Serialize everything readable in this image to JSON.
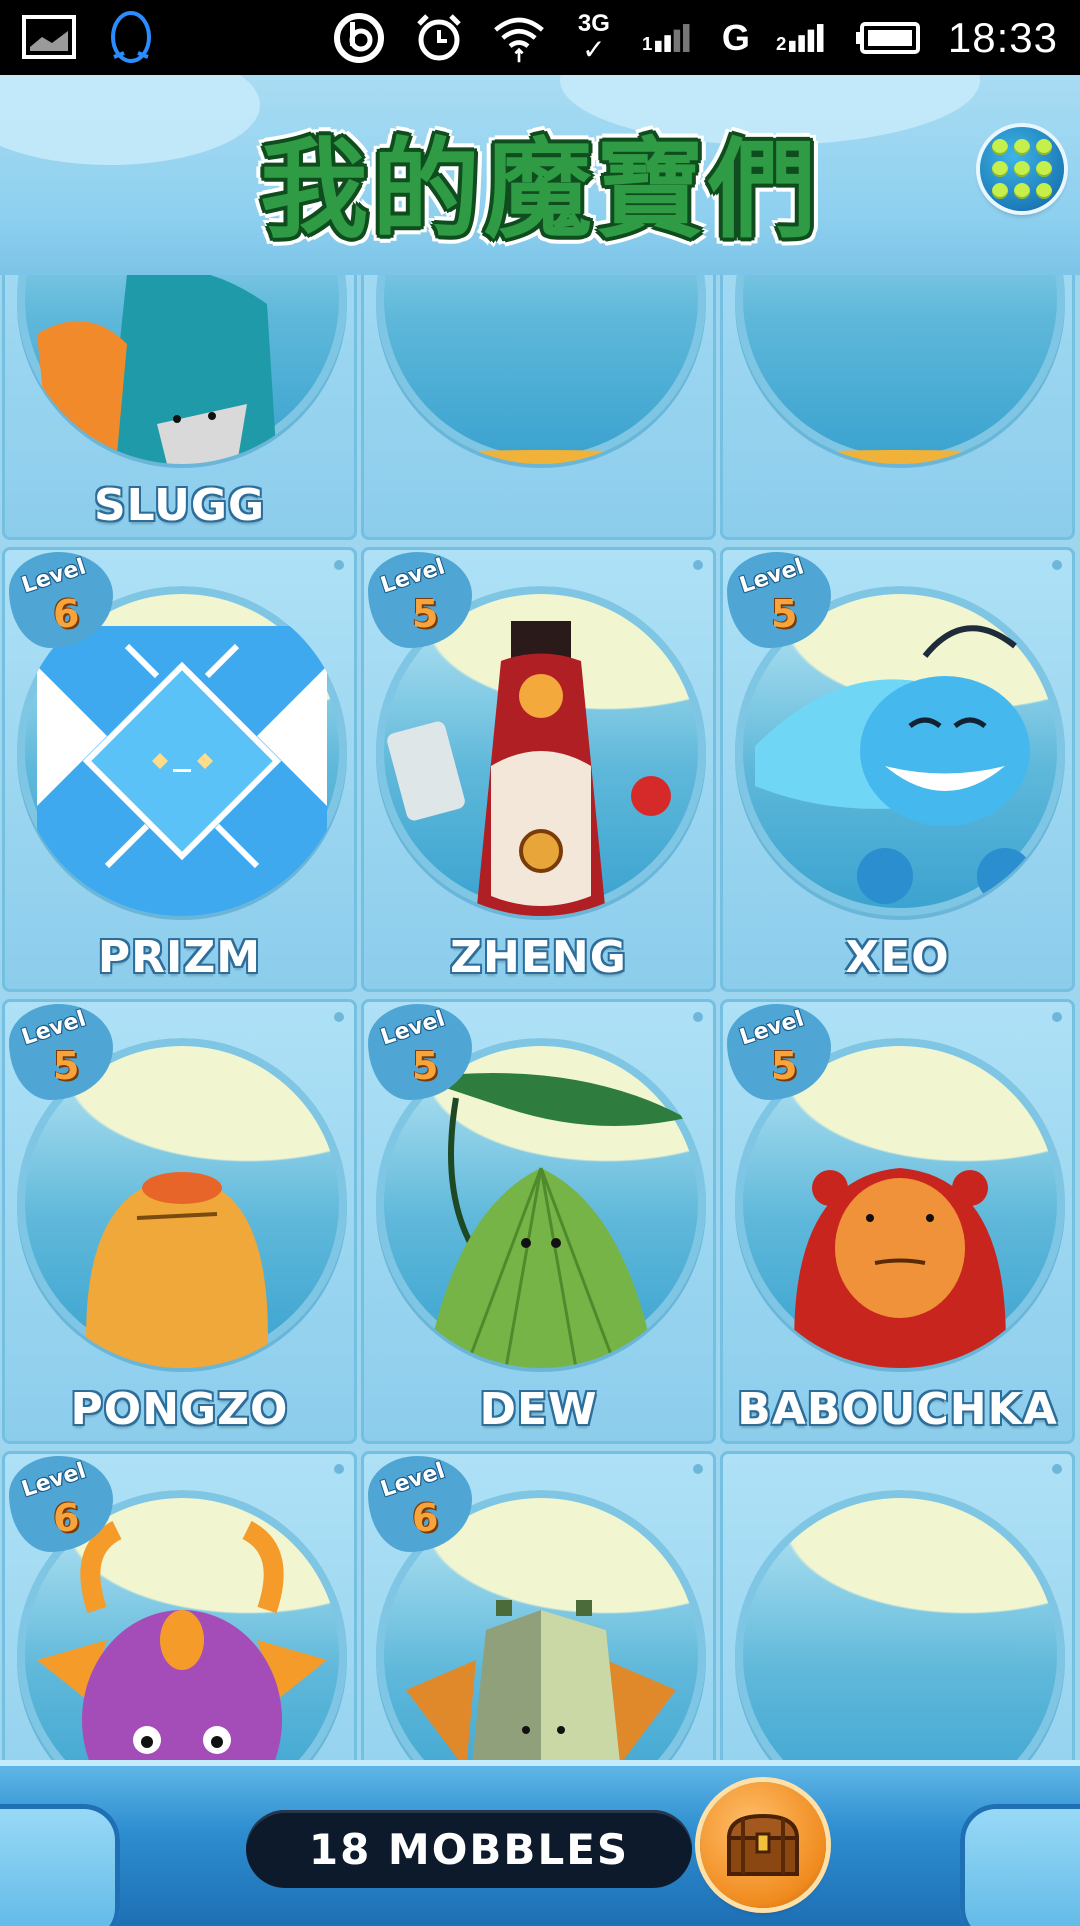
{
  "status_bar": {
    "time": "18:33",
    "network_3g": "3G",
    "network_g": "G",
    "icons": [
      "screenshot-icon",
      "qq-penguin-icon",
      "beats-icon",
      "alarm-icon",
      "wifi-icon",
      "signal-icon",
      "battery-icon"
    ]
  },
  "header": {
    "title": "我的魔寶們",
    "menu_icon": "grid-menu-icon"
  },
  "mobbles": [
    {
      "name": "SLUGG",
      "level": ""
    },
    {
      "name": "",
      "level": ""
    },
    {
      "name": "",
      "level": ""
    },
    {
      "name": "PRIZM",
      "level": "6",
      "level_label": "Level"
    },
    {
      "name": "ZHENG",
      "level": "5",
      "level_label": "Level"
    },
    {
      "name": "XEO",
      "level": "5",
      "level_label": "Level"
    },
    {
      "name": "PONGZO",
      "level": "5",
      "level_label": "Level"
    },
    {
      "name": "DEW",
      "level": "5",
      "level_label": "Level"
    },
    {
      "name": "BABOUCHKA",
      "level": "5",
      "level_label": "Level"
    },
    {
      "name": "",
      "level": "6",
      "level_label": "Level"
    },
    {
      "name": "",
      "level": "6",
      "level_label": "Level"
    },
    {
      "name": "",
      "level": ""
    }
  ],
  "footer": {
    "count_label": "18 MOBBLES",
    "chest_icon": "treasure-chest-icon"
  },
  "colors": {
    "title_green": "#2f9b45",
    "card_blue": "#aee1f6",
    "level_orange": "#f7a43c",
    "counter_bg": "#0d1a2b"
  }
}
